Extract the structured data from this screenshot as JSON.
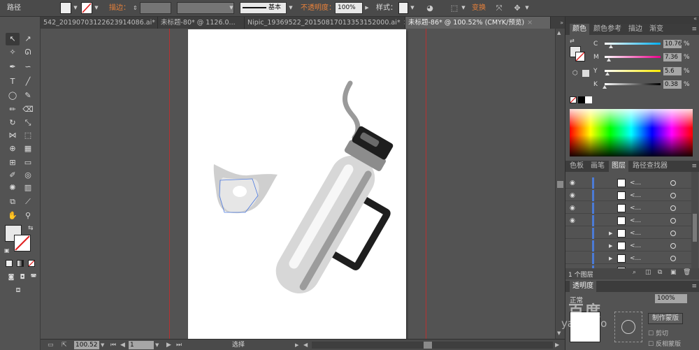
{
  "control_bar": {
    "object_type": "路径",
    "stroke_label": "描边：",
    "brush_label": "基本",
    "opacity_label": "不透明度：",
    "opacity_value": "100%",
    "style_label": "样式：",
    "transform_label": "变换"
  },
  "doc_tabs": [
    {
      "label": "542_20190703122623914086.ai*",
      "active": false
    },
    {
      "label": "未标题-80* @ 1126.0...",
      "active": false
    },
    {
      "label": "Nipic_19369522_20150817013353152000.ai*",
      "active": false
    },
    {
      "label": "未标题-86* @ 100.52% (CMYK/预览)",
      "active": true
    }
  ],
  "color_panel": {
    "tabs": [
      "颜色",
      "颜色参考",
      "描边",
      "渐变"
    ],
    "active_tab": "颜色",
    "channels": [
      {
        "name": "C",
        "value": "10.76",
        "level": 0.1076,
        "track": "linear-gradient(90deg,#fff,#00aeef)"
      },
      {
        "name": "M",
        "value": "7.36",
        "level": 0.0736,
        "track": "linear-gradient(90deg,#fff,#ec008c)"
      },
      {
        "name": "Y",
        "value": "5.6",
        "level": 0.056,
        "track": "linear-gradient(90deg,#fff,#ffec00)"
      },
      {
        "name": "K",
        "value": "0.38",
        "level": 0.0038,
        "track": "linear-gradient(90deg,#fff,#000)"
      }
    ],
    "percent": "%"
  },
  "layers_panel": {
    "tabs": [
      "色板",
      "画笔",
      "图层",
      "路径查找器"
    ],
    "active_tab": "图层",
    "rows": [
      {
        "name": "<...",
        "eye": true,
        "expand": false
      },
      {
        "name": "<...",
        "eye": true,
        "expand": false
      },
      {
        "name": "<...",
        "eye": true,
        "expand": false
      },
      {
        "name": "<...",
        "eye": true,
        "expand": false
      },
      {
        "name": "<...",
        "eye": false,
        "expand": true
      },
      {
        "name": "<...",
        "eye": false,
        "expand": true
      },
      {
        "name": "<...",
        "eye": false,
        "expand": true
      },
      {
        "name": "<...",
        "eye": true,
        "expand": false
      }
    ],
    "footer": "1 个图层"
  },
  "transparency_panel": {
    "tab": "透明度",
    "mode": "正常",
    "opacity_value": "100%",
    "make_mask": "制作蒙版",
    "clip": "剪切",
    "invert_mask": "反相蒙版"
  },
  "status_bar": {
    "zoom": "100.52",
    "page": "1",
    "tool": "选择"
  },
  "watermark": "yan b do"
}
